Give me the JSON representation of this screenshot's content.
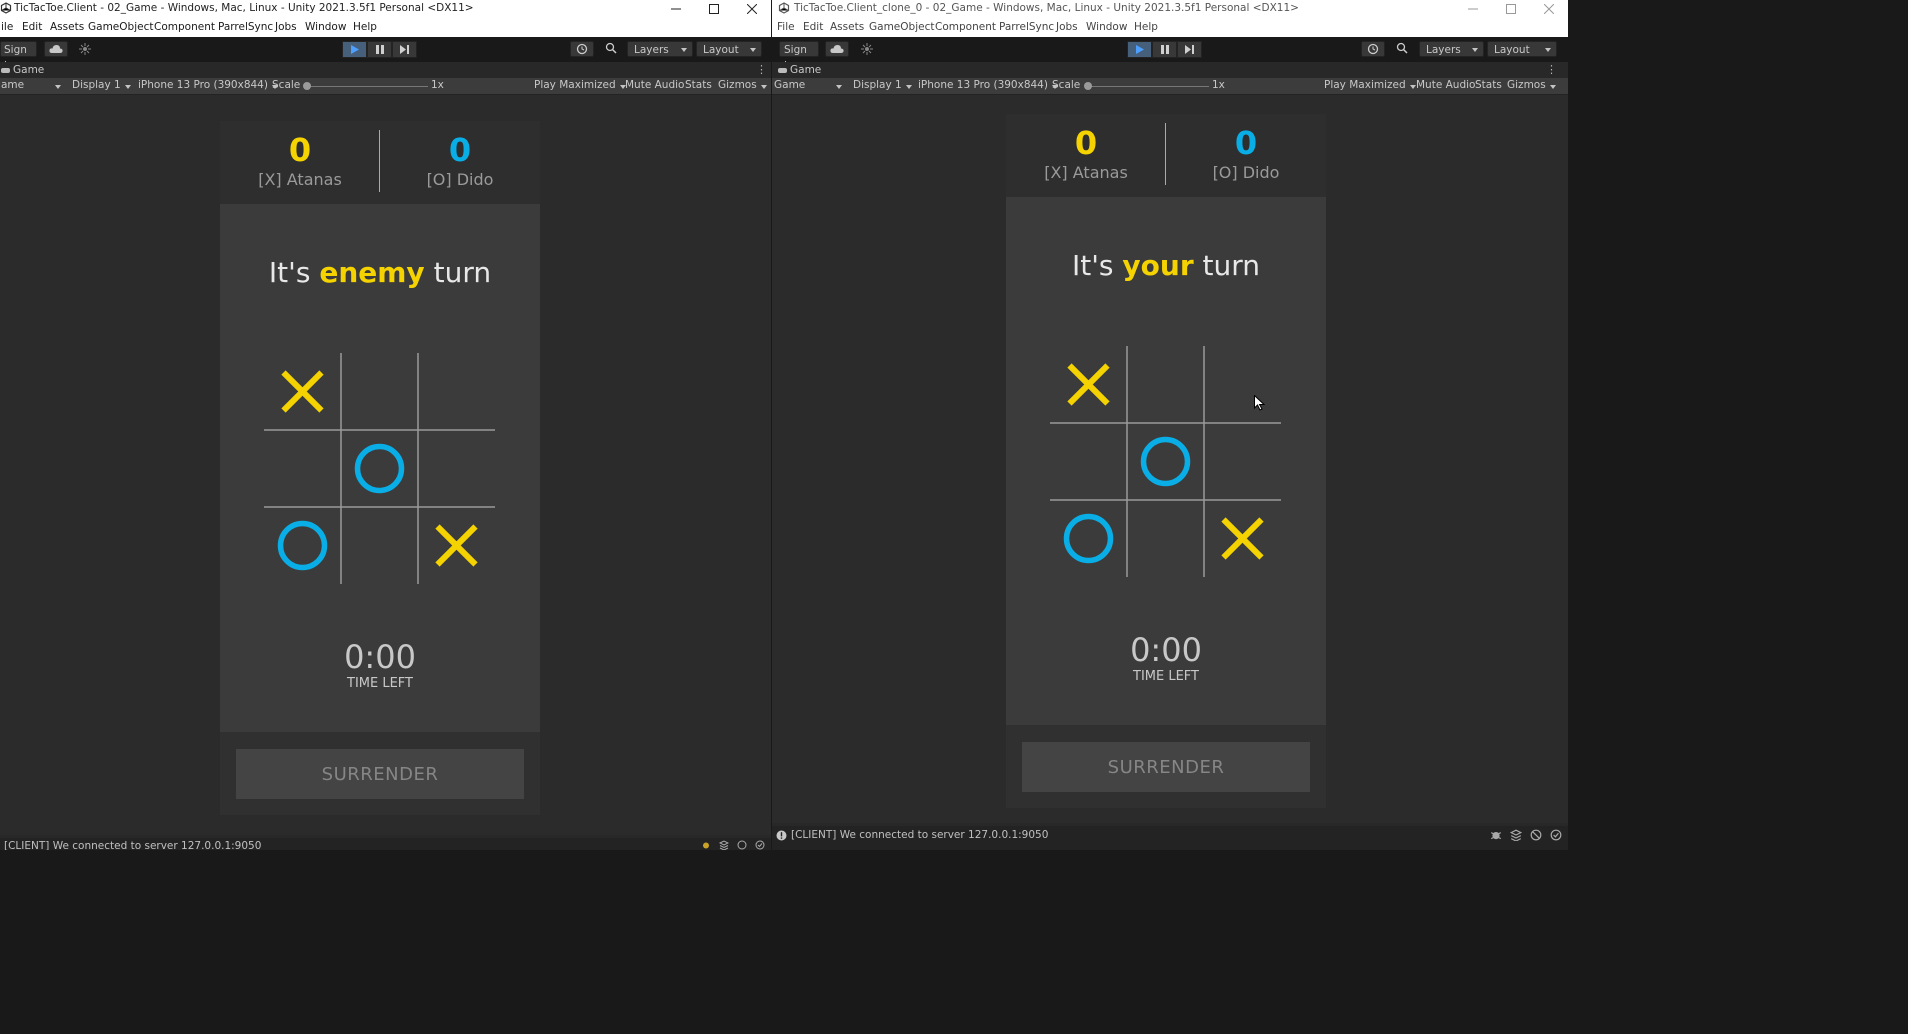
{
  "windows": {
    "left": {
      "title": "TicTacToe.Client - 02_Game - Windows, Mac, Linux - Unity 2021.3.5f1 Personal <DX11>",
      "menu": [
        "ile",
        "Edit",
        "Assets",
        "GameObject",
        "Component",
        "ParrelSync",
        "Jobs",
        "Window",
        "Help"
      ],
      "game_view_dropdown": "ame",
      "status_message": "[CLIENT] We connected to server 127.0.0.1:9050",
      "turn": {
        "prefix": "It's",
        "highlight": "enemy",
        "suffix": "turn"
      }
    },
    "right": {
      "title": "TicTacToe.Client_clone_0 - 02_Game - Windows, Mac, Linux - Unity 2021.3.5f1 Personal <DX11>",
      "menu": [
        "File",
        "Edit",
        "Assets",
        "GameObject",
        "Component",
        "ParrelSync",
        "Jobs",
        "Window",
        "Help"
      ],
      "game_view_dropdown": "Game",
      "status_message": "[CLIENT] We connected to server 127.0.0.1:9050",
      "turn": {
        "prefix": "It's",
        "highlight": "your",
        "suffix": "turn"
      }
    }
  },
  "toolbar": {
    "sign_in": "Sign in",
    "layers": "Layers",
    "layout": "Layout"
  },
  "tab": {
    "label": "Game"
  },
  "game_toolbar": {
    "display": "Display 1",
    "resolution": "iPhone 13 Pro (390x844)",
    "scale_label": "Scale",
    "scale_value": "1x",
    "play_maximized": "Play Maximized",
    "mute_audio": "Mute Audio",
    "stats": "Stats",
    "gizmos": "Gizmos"
  },
  "game": {
    "player_x": {
      "score": "0",
      "name": "[X] Atanas",
      "color": "#f5d300"
    },
    "player_o": {
      "score": "0",
      "name": "[O] Dido",
      "color": "#0aaee6"
    },
    "board": [
      "X",
      "",
      "",
      "",
      "O",
      "",
      "O",
      "",
      "X"
    ],
    "timer": "0:00",
    "timer_label": "TIME LEFT",
    "surrender_label": "SURRENDER"
  },
  "colors": {
    "x_mark": "#f5d300",
    "o_mark": "#0aaee6"
  }
}
